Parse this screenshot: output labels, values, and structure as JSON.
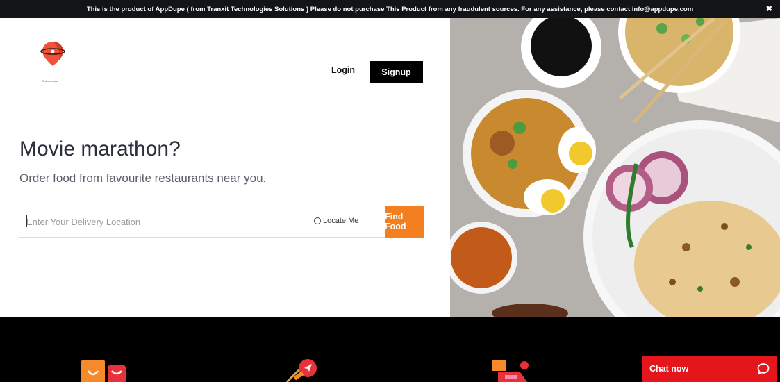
{
  "notice": {
    "text": "This is the product of AppDupe ( from Tranxit Technologies Solutions ) Please do not purchase This Product from any fraudulent sources. For any assistance, please contact info@appdupe.com",
    "close_glyph": "✖"
  },
  "header": {
    "logo_icon": "delivery-pin-logo-icon",
    "logo_tagline": "Order around",
    "login_label": "Login",
    "signup_label": "Signup"
  },
  "hero": {
    "title": "Movie marathon?",
    "subtitle": "Order food from favourite restaurants near you.",
    "search": {
      "placeholder": "Enter Your Delivery Location",
      "value": "",
      "locate_label": "Locate Me",
      "submit_label": "Find Food"
    },
    "image_icon": "food-platter-photo"
  },
  "features": {
    "icons": [
      "shopping-bag-icon",
      "map-navigation-icon",
      "delivery-scooter-icon"
    ]
  },
  "chat": {
    "label": "Chat now",
    "icon": "chat-bubble-icon"
  },
  "colors": {
    "accent": "#f37f21",
    "notice_bg": "#121417",
    "footer_bg": "#000000",
    "chat_bg": "#e4161c",
    "text_dark": "#2a2f3b"
  }
}
